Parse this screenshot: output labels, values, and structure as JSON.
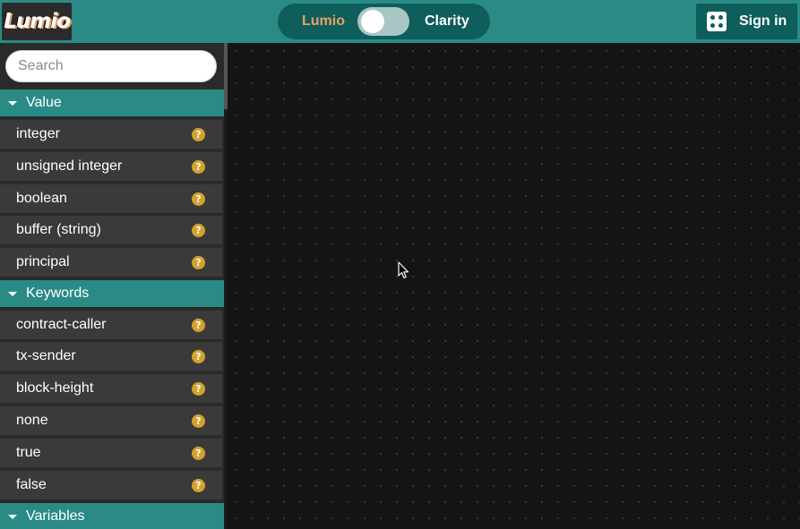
{
  "header": {
    "logo_text": "Lumio",
    "toggle": {
      "left_label": "Lumio",
      "right_label": "Clarity"
    },
    "signin_label": "Sign in"
  },
  "sidebar": {
    "search": {
      "placeholder": "Search",
      "value": ""
    },
    "categories": [
      {
        "label": "Value",
        "items": [
          {
            "label": "integer",
            "help": "?"
          },
          {
            "label": "unsigned integer",
            "help": "?"
          },
          {
            "label": "boolean",
            "help": "?"
          },
          {
            "label": "buffer (string)",
            "help": "?"
          },
          {
            "label": "principal",
            "help": "?"
          }
        ]
      },
      {
        "label": "Keywords",
        "items": [
          {
            "label": "contract-caller",
            "help": "?"
          },
          {
            "label": "tx-sender",
            "help": "?"
          },
          {
            "label": "block-height",
            "help": "?"
          },
          {
            "label": "none",
            "help": "?"
          },
          {
            "label": "true",
            "help": "?"
          },
          {
            "label": "false",
            "help": "?"
          }
        ]
      },
      {
        "label": "Variables",
        "items": []
      }
    ]
  },
  "colors": {
    "accent": "#2a8a86",
    "accent_dark": "#0e5e5c",
    "highlight": "#e8a262",
    "help_badge": "#d4a22c",
    "item_bg": "#3a3a3a",
    "canvas_bg": "#141414"
  },
  "icons": {
    "signin": "apps-grid-icon",
    "category": "caret-down-icon",
    "help": "help-circle-icon",
    "cursor": "mouse-pointer-icon"
  }
}
